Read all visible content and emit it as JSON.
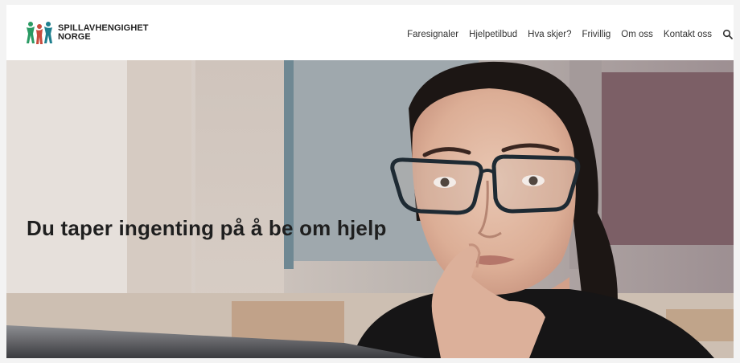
{
  "brand": {
    "line1": "SPILLAVHENGIGHET",
    "line2": "NORGE",
    "logo_icon": "people-figures-icon",
    "colors": {
      "green": "#2a9a63",
      "teal": "#1f7f8e",
      "red": "#c94a3c"
    }
  },
  "nav": {
    "items": [
      {
        "label": "Faresignaler"
      },
      {
        "label": "Hjelpetilbud"
      },
      {
        "label": "Hva skjer?"
      },
      {
        "label": "Frivillig"
      },
      {
        "label": "Om oss"
      },
      {
        "label": "Kontakt oss"
      }
    ],
    "search_icon": "search-icon"
  },
  "hero": {
    "headline": "Du taper ingenting på å be om hjelp",
    "image": "woman-with-glasses-at-monitor-photo"
  }
}
